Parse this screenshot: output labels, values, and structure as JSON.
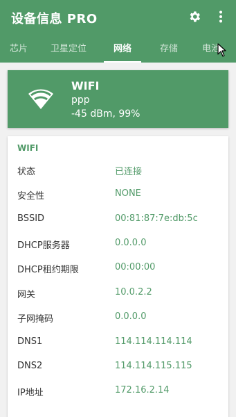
{
  "header": {
    "title": "设备信息 PRO",
    "tabs": [
      "芯片",
      "卫星定位",
      "网络",
      "存储",
      "电池"
    ]
  },
  "wifi_card": {
    "title": "WIFI",
    "ssid": "ppp",
    "signal": "-45 dBm, 99%"
  },
  "details": {
    "section_title": "WIFI",
    "rows": [
      {
        "label": "状态",
        "value": "已连接"
      },
      {
        "label": "安全性",
        "value": "NONE"
      },
      {
        "label": "BSSID",
        "value": "00:81:87:7e:db:5c"
      },
      {
        "label": "DHCP服务器",
        "value": "0.0.0.0"
      },
      {
        "label": "DHCP租约期限",
        "value": "00:00:00"
      },
      {
        "label": "网关",
        "value": "10.0.2.2"
      },
      {
        "label": "子网掩码",
        "value": "0.0.0.0"
      },
      {
        "label": "DNS1",
        "value": "114.114.114.114"
      },
      {
        "label": "DNS2",
        "value": "114.114.115.115"
      },
      {
        "label": "IP地址",
        "value": "172.16.2.14"
      }
    ]
  },
  "colors": {
    "primary": "#519a68",
    "background": "#f1f1f1"
  }
}
